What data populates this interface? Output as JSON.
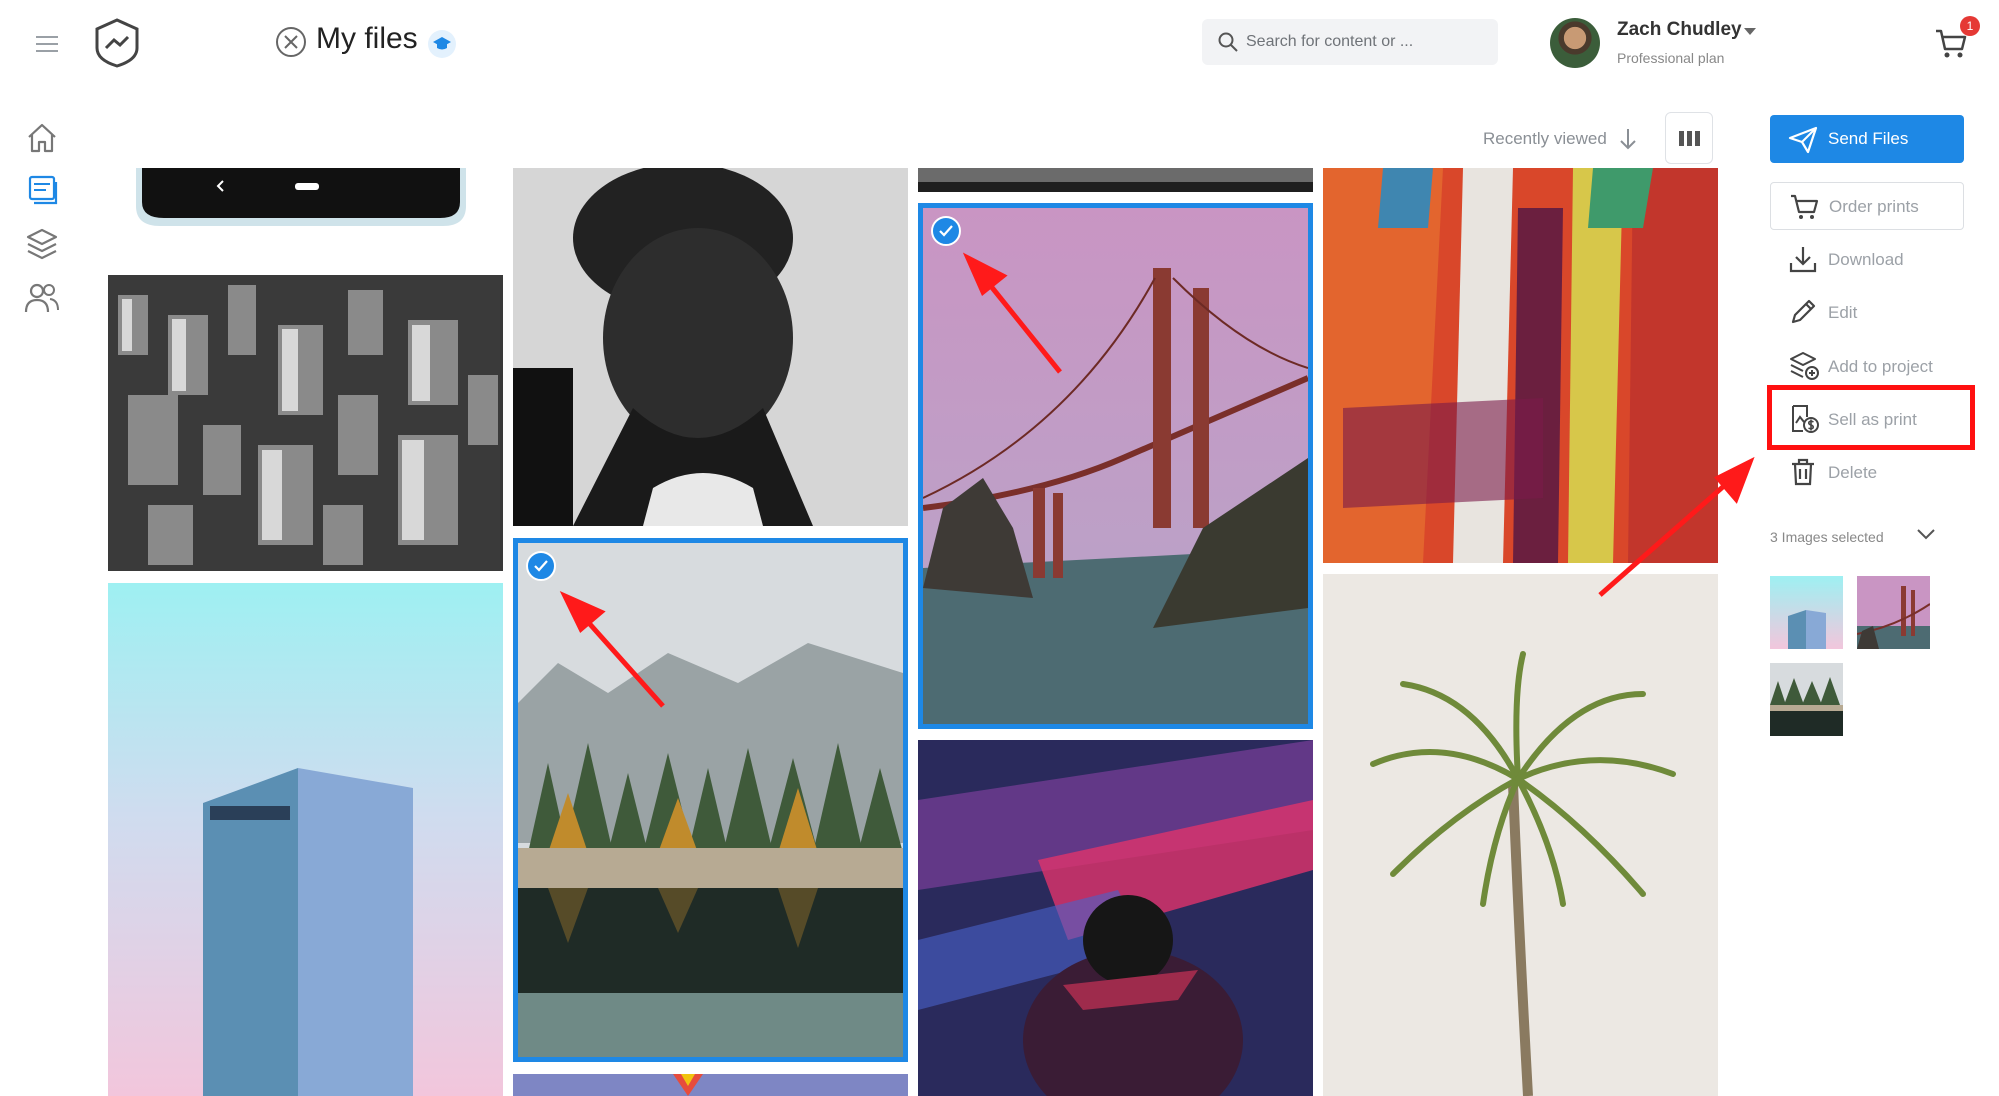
{
  "header": {
    "page_title": "My files",
    "search_placeholder": "Search for content or ...",
    "user_name": "Zach Chudley",
    "user_plan": "Professional plan",
    "cart_count": "1"
  },
  "left_nav": {
    "items": [
      "home-icon",
      "library-icon",
      "layers-icon",
      "users-icon"
    ],
    "active": "library-icon"
  },
  "toolbar": {
    "sort_label": "Recently viewed"
  },
  "actions": {
    "send_label": "Send Files",
    "order_label": "Order prints",
    "download_label": "Download",
    "edit_label": "Edit",
    "add_project_label": "Add to project",
    "sell_label": "Sell as print",
    "delete_label": "Delete",
    "selected_count_label": "3 Images selected"
  },
  "colors": {
    "accent": "#1e88e5",
    "highlight": "#ff1010",
    "badge": "#e53935"
  }
}
